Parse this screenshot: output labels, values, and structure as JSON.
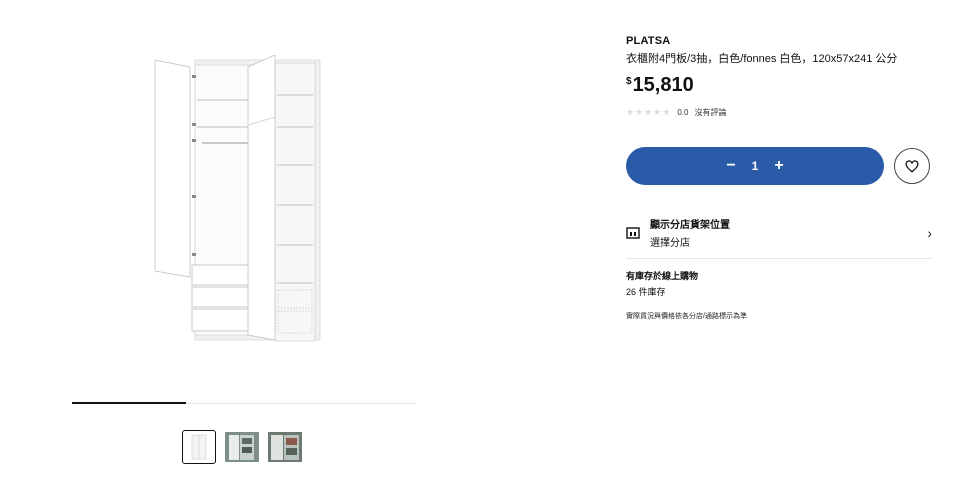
{
  "product": {
    "name": "PLATSA",
    "description": "衣櫃附4門板/3抽，白色/fonnes 白色，120x57x241 公分",
    "currency": "$",
    "price": "15,810",
    "rating_value": "0.0",
    "rating_text": "沒有評論",
    "rating_stars": 0
  },
  "cart": {
    "minus": "−",
    "quantity": "1",
    "plus": "+"
  },
  "store": {
    "title": "顯示分店貨架位置",
    "subtitle": "選擇分店"
  },
  "stock": {
    "title": "有庫存於線上購物",
    "count": "26 件庫存",
    "note": "實際貨況與價格依各分店/通路標示為準"
  },
  "gallery": {
    "progress": 0.33,
    "thumbnails": [
      "wardrobe-white-product",
      "wardrobe-room-1",
      "wardrobe-room-2"
    ],
    "active_index": 0
  },
  "colors": {
    "accent": "#2a5aa8"
  }
}
